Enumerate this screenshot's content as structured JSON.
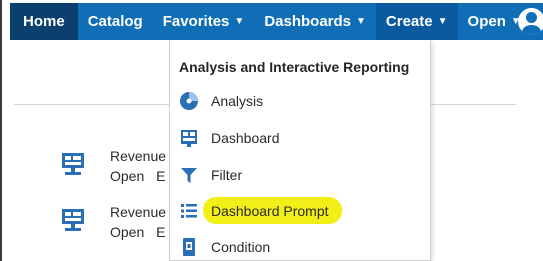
{
  "nav": {
    "home": "Home",
    "catalog": "Catalog",
    "favorites": "Favorites",
    "dashboards": "Dashboards",
    "create": "Create",
    "open": "Open"
  },
  "recent_items": [
    {
      "title": "Revenue",
      "sub": "Open E"
    },
    {
      "title": "Revenue",
      "sub": "Open E"
    }
  ],
  "menu": {
    "header": "Analysis and Interactive Reporting",
    "items": [
      {
        "label": "Analysis",
        "icon": "analysis-icon"
      },
      {
        "label": "Dashboard",
        "icon": "dashboard-icon"
      },
      {
        "label": "Filter",
        "icon": "filter-icon"
      },
      {
        "label": "Dashboard Prompt",
        "icon": "prompt-list-icon",
        "highlighted": true
      },
      {
        "label": "Condition",
        "icon": "condition-icon"
      }
    ]
  },
  "colors": {
    "navbar": "#0f6eb6",
    "nav_active": "#0a3f6e",
    "icon_blue": "#2a6fb5",
    "highlight": "#f2ee18"
  }
}
